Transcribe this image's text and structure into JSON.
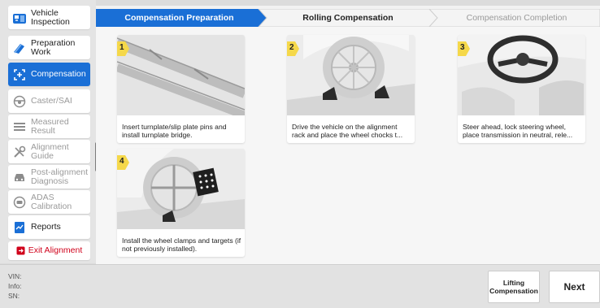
{
  "sidebar": {
    "items": [
      {
        "label": "Vehicle Inspection",
        "icon": "vehicle-inspection-icon",
        "state": "normal"
      },
      {
        "label": "Preparation Work",
        "icon": "preparation-icon",
        "state": "normal"
      },
      {
        "label": "Compensation",
        "icon": "compensation-icon",
        "state": "active"
      },
      {
        "label": "Caster/SAI",
        "icon": "steering-wheel-icon",
        "state": "disabled"
      },
      {
        "label": "Measured Result",
        "icon": "measured-result-icon",
        "state": "disabled"
      },
      {
        "label": "Alignment Guide",
        "icon": "wrench-icon",
        "state": "disabled"
      },
      {
        "label": "Post-alignment Diagnosis",
        "icon": "car-diagnosis-icon",
        "state": "disabled"
      },
      {
        "label": "ADAS Calibration",
        "icon": "adas-icon",
        "state": "disabled"
      },
      {
        "label": "Reports",
        "icon": "report-icon",
        "state": "normal"
      }
    ],
    "exit_label": "Exit Alignment"
  },
  "steps": [
    {
      "label": "Compensation Preparation",
      "state": "active"
    },
    {
      "label": "Rolling Compensation",
      "state": "normal"
    },
    {
      "label": "Compensation Completion",
      "state": "disabled"
    }
  ],
  "cards": [
    {
      "number": "1",
      "text": "Insert turnplate/slip plate pins and install turnplate bridge."
    },
    {
      "number": "2",
      "text": "Drive the vehicle on the alignment rack and place the wheel chocks t..."
    },
    {
      "number": "3",
      "text": "Steer ahead, lock steering wheel, place transmission in neutral, rele..."
    },
    {
      "number": "4",
      "text": "Install the wheel clamps and targets (if not previously installed)."
    }
  ],
  "info": {
    "vin_label": "VIN:",
    "info_label": "Info:",
    "sn_label": "SN:"
  },
  "buttons": {
    "lifting_label": "Lifting Compensation",
    "next_label": "Next"
  },
  "colors": {
    "accent": "#1a6fd6",
    "badge": "#f5d84a",
    "exit": "#d0021b"
  }
}
